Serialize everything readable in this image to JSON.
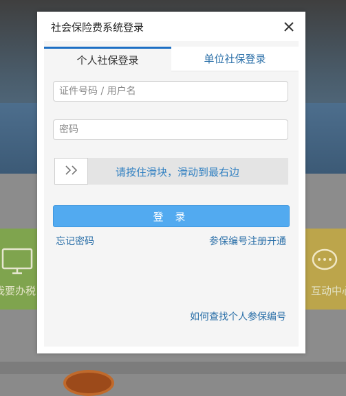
{
  "modal": {
    "title": "社会保险费系统登录",
    "close_icon": "close-icon"
  },
  "tabs": [
    {
      "label": "个人社保登录",
      "active": true
    },
    {
      "label": "单位社保登录",
      "active": false
    }
  ],
  "form": {
    "username_placeholder": "证件号码 / 用户名",
    "username_value": "",
    "password_placeholder": "密码",
    "password_value": "",
    "slider_text": "请按住滑块，滑动到最右边",
    "slider_icon": "double-chevron-right-icon",
    "login_label": "登 录"
  },
  "links": {
    "forgot_password": "忘记密码",
    "register": "参保编号注册开通",
    "lookup": "如何查找个人参保编号"
  },
  "background": {
    "tile_left_label": "我要办税",
    "tile_right_label": "互动中心",
    "tile_left_icon": "monitor-icon",
    "tile_right_icon": "chat-icon"
  },
  "colors": {
    "accent": "#1d6fc4",
    "login_button": "#52aaf0",
    "link": "#2a6fa8",
    "slider_text": "#2f7fc1"
  }
}
